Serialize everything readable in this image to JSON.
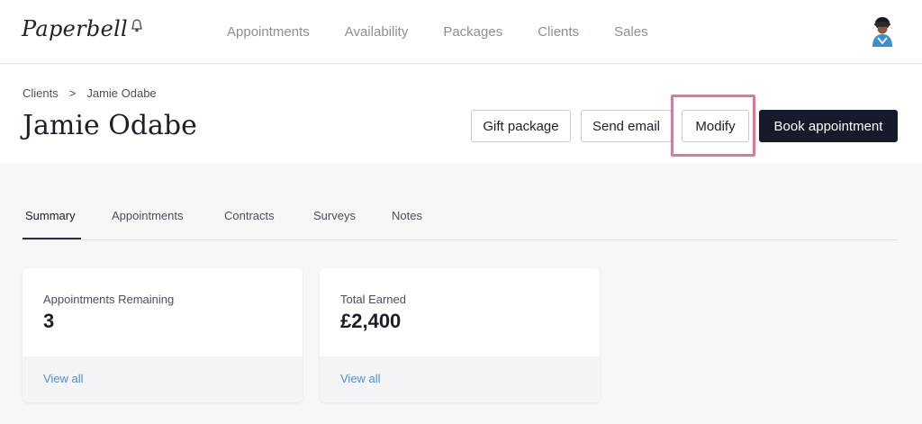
{
  "brand": {
    "name": "Paperbell"
  },
  "nav": {
    "items": [
      {
        "label": "Appointments"
      },
      {
        "label": "Availability"
      },
      {
        "label": "Packages"
      },
      {
        "label": "Clients"
      },
      {
        "label": "Sales"
      }
    ]
  },
  "breadcrumb": {
    "parent": "Clients",
    "separator": ">",
    "current": "Jamie Odabe"
  },
  "page": {
    "title": "Jamie Odabe"
  },
  "actions": {
    "gift_package": "Gift package",
    "send_email": "Send email",
    "modify": "Modify",
    "book_appointment": "Book appointment"
  },
  "tabs": [
    {
      "label": "Summary",
      "active": true
    },
    {
      "label": "Appointments",
      "active": false
    },
    {
      "label": "Contracts",
      "active": false
    },
    {
      "label": "Surveys",
      "active": false
    },
    {
      "label": "Notes",
      "active": false
    }
  ],
  "cards": [
    {
      "label": "Appointments Remaining",
      "value": "3",
      "link": "View all"
    },
    {
      "label": "Total Earned",
      "value": "£2,400",
      "link": "View all"
    }
  ],
  "colors": {
    "primary_dark": "#161a2b",
    "link": "#4f8fd6",
    "highlight": "#e8739a",
    "muted_text": "#8a8f99",
    "content_bg": "#f6f7f8"
  }
}
